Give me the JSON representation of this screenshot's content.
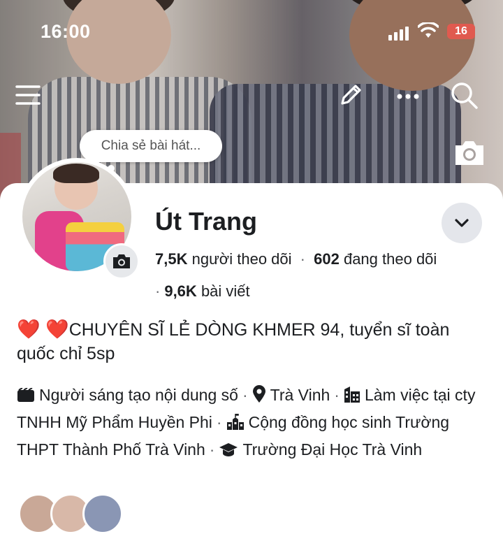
{
  "status_bar": {
    "time": "16:00",
    "battery": "16"
  },
  "cover": {
    "share_song_placeholder": "Chia sẻ bài hát..."
  },
  "profile": {
    "name": "Út Trang",
    "followers_count": "7,5K",
    "followers_label": "người theo dõi",
    "following_count": "602",
    "following_label": "đang theo dõi",
    "posts_count": "9,6K",
    "posts_label": "bài viết",
    "bio_hearts": "❤️ ❤️",
    "bio_text": "CHUYÊN SĨ LẺ DÒNG KHMER 94, tuyển sĩ toàn quốc chỉ 5sp",
    "details": {
      "creator": "Người sáng tạo nội dung số",
      "location": "Trà Vinh",
      "work": "Làm việc tại cty TNHH Mỹ Phẩm Huyền Phi",
      "community": "Cộng đồng học sinh Trường THPT Thành Phố Trà Vinh",
      "education": "Trường Đại Học Trà Vinh"
    }
  },
  "icons": [
    "menu-icon",
    "edit-icon",
    "more-icon",
    "search-icon",
    "camera-icon",
    "chevron-down-icon",
    "video-icon",
    "location-icon",
    "building-icon",
    "school-icon",
    "graduation-cap-icon"
  ],
  "colors": {
    "heart": "#e0202b",
    "text": "#1c1e21",
    "secondary": "#65676b",
    "button_bg": "#e4e6eb"
  }
}
